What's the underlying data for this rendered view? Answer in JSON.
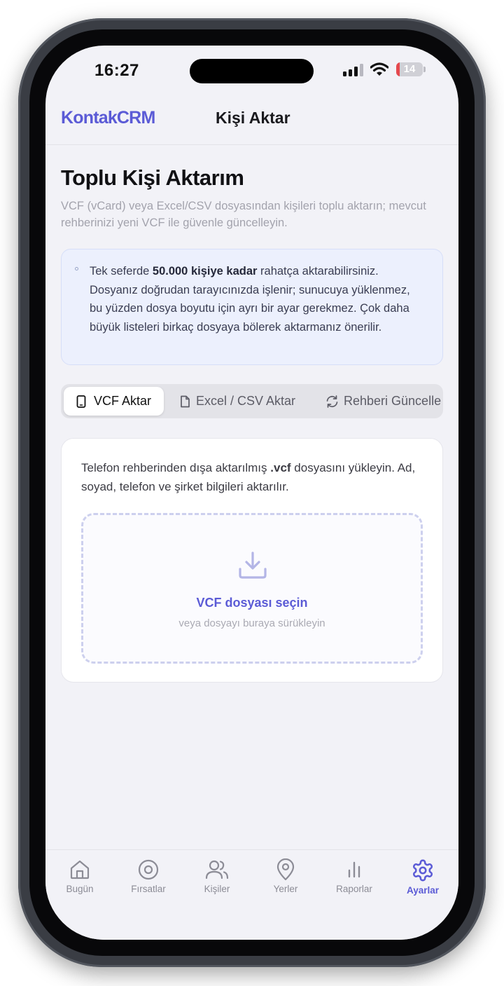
{
  "status_bar": {
    "time": "16:27",
    "battery": "14",
    "battery_level": 0.14
  },
  "header": {
    "brand": "KontakCRM",
    "title": "Kişi Aktar"
  },
  "page": {
    "title": "Toplu Kişi Aktarım",
    "subtitle": "VCF (vCard) veya Excel/CSV dosyasından kişileri toplu aktarın; mevcut rehberinizi yeni VCF ile güvenle güncelleyin."
  },
  "info": {
    "prefix": "Tek seferde ",
    "highlight": "50.000 kişiye kadar",
    "suffix": " rahatça aktarabilirsiniz. Dosyanız doğrudan tarayıcınızda işlenir; sunucuya yüklenmez, bu yüzden dosya boyutu için ayrı bir ayar gerekmez. Çok daha büyük listeleri birkaç dosyaya bölerek aktarmanız önerilir."
  },
  "tabs": [
    {
      "label": "VCF Aktar",
      "icon": "phone-icon",
      "active": true
    },
    {
      "label": "Excel / CSV Aktar",
      "icon": "file-icon",
      "active": false
    },
    {
      "label": "Rehberi Güncelle",
      "icon": "refresh-icon",
      "active": false
    }
  ],
  "upload": {
    "desc_prefix": "Telefon rehberinden dışa aktarılmış ",
    "desc_highlight": ".vcf",
    "desc_suffix": " dosyasını yükleyin. Ad, soyad, telefon ve şirket bilgileri aktarılır.",
    "drop_title": "VCF dosyası seçin",
    "drop_hint": "veya dosyayı buraya sürükleyin",
    "icon": "download-icon"
  },
  "bottom_nav": [
    {
      "label": "Bugün",
      "icon": "home-icon",
      "active": false
    },
    {
      "label": "Fırsatlar",
      "icon": "target-icon",
      "active": false
    },
    {
      "label": "Kişiler",
      "icon": "users-icon",
      "active": false
    },
    {
      "label": "Yerler",
      "icon": "map-pin-icon",
      "active": false
    },
    {
      "label": "Raporlar",
      "icon": "bar-chart-icon",
      "active": false
    },
    {
      "label": "Ayarlar",
      "icon": "gear-icon",
      "active": true
    }
  ],
  "colors": {
    "accent": "#5b5bd6",
    "info_bg": "#ecf0fd",
    "battery_low": "#e5484d"
  }
}
